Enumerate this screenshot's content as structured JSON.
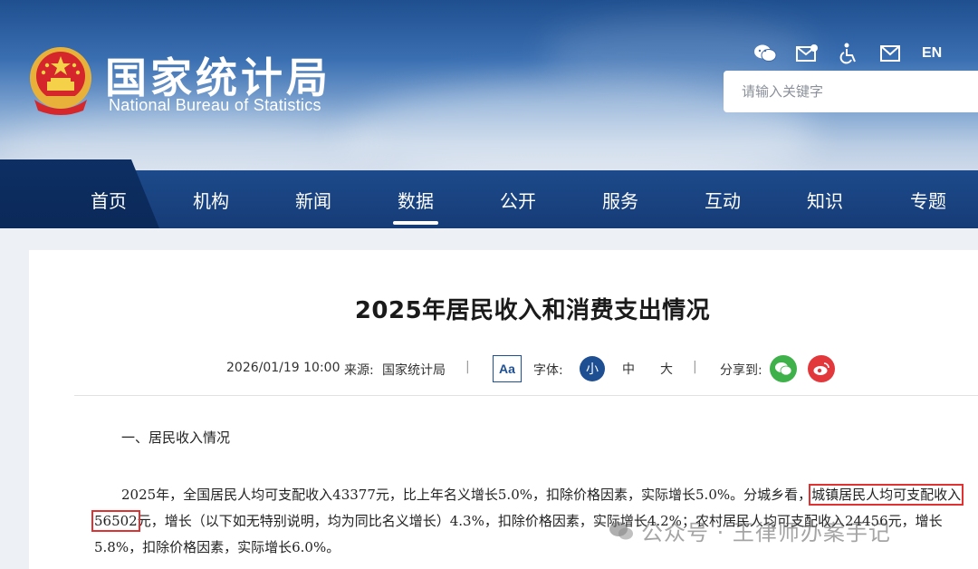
{
  "site": {
    "title_cn": "国家统计局",
    "title_en": "National Bureau of Statistics",
    "top_icons": [
      "wechat-icon",
      "mail-plus-icon",
      "accessibility-icon",
      "mail-icon"
    ],
    "lang_label": "EN",
    "search_placeholder": "请输入关键字"
  },
  "nav": {
    "items": [
      {
        "label": "首页",
        "icon": "home"
      },
      {
        "label": "机构"
      },
      {
        "label": "新闻"
      },
      {
        "label": "数据",
        "active": true
      },
      {
        "label": "公开"
      },
      {
        "label": "服务"
      },
      {
        "label": "互动"
      },
      {
        "label": "知识"
      },
      {
        "label": "专题"
      }
    ]
  },
  "article": {
    "title": "2025年居民收入和消费支出情况",
    "date": "2026/01/19 10:00",
    "source_label": "来源:",
    "source": "国家统计局",
    "aa_label": "Aa",
    "font_label": "字体:",
    "font_sizes": [
      "小",
      "中",
      "大"
    ],
    "share_label": "分享到:",
    "share_icons": [
      "wechat-share-icon",
      "weibo-share-icon"
    ],
    "section_heading": "一、居民收入情况",
    "para_part1": "2025年，全国居民人均可支配收入43377元，比上年名义增长5.0%，扣除价格因素，实际增长5.0%。分城乡看，",
    "para_highlight": "城镇居民人均可支配收入56502",
    "para_part2": "元，增长（以下如无特别说明，均为同比名义增长）4.3%，扣除价格因素，实际增长4.2%；农村居民人均可支配收入24456元，增长5.8%，扣除价格因素，实际增长6.0%。"
  },
  "watermark": {
    "text": "公众号 · 王律师办案手记"
  },
  "colors": {
    "nav_bg": "#163c76",
    "accent": "#1e4f92",
    "highlight_border": "#e03232"
  }
}
